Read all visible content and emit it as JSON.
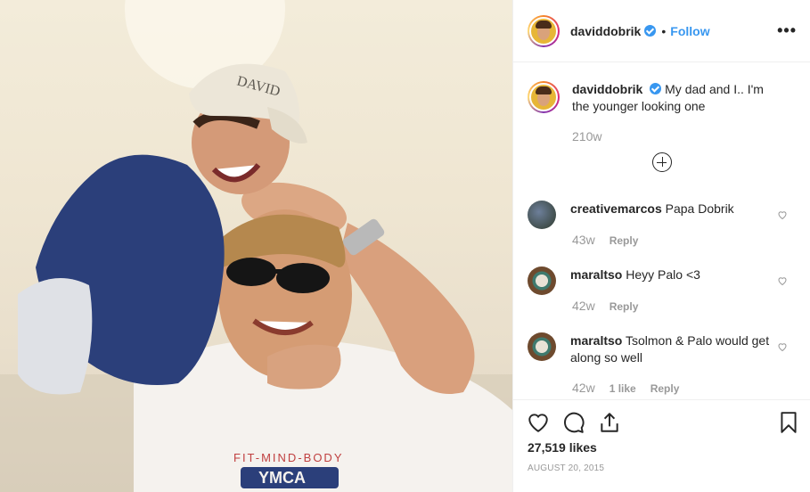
{
  "post": {
    "username": "daviddobrik",
    "follow_label": "Follow",
    "separator": "•",
    "more_label": "•••",
    "cap_text": "I'm the younger looking one",
    "caption_user": "daviddobrik",
    "caption_text": "My dad and I.. I'm the younger looking one",
    "caption_time": "210w",
    "cap_letters": "DAVID",
    "shirt_text": "FIT-MIND-BODY",
    "shirt_logo": "YMCA"
  },
  "comments": [
    {
      "user": "creativemarcos",
      "text": "Papa Dobrik",
      "time": "43w",
      "likes": "",
      "reply_label": "Reply"
    },
    {
      "user": "maraltso",
      "text": "Heyy Palo <3",
      "time": "42w",
      "likes": "",
      "reply_label": "Reply"
    },
    {
      "user": "maraltso",
      "text": "Tsolmon & Palo would get along so well",
      "time": "42w",
      "likes": "1 like",
      "reply_label": "Reply"
    }
  ],
  "footer": {
    "likes": "27,519 likes",
    "date": "AUGUST 20, 2015"
  },
  "icons": [
    "verified-badge-icon",
    "more-options-icon",
    "load-more-comments-icon",
    "heart-icon",
    "comment-icon",
    "share-icon",
    "bookmark-icon"
  ],
  "colors": {
    "accent": "#3897f0",
    "muted": "#999999",
    "text": "#262626",
    "border": "#efefef"
  }
}
